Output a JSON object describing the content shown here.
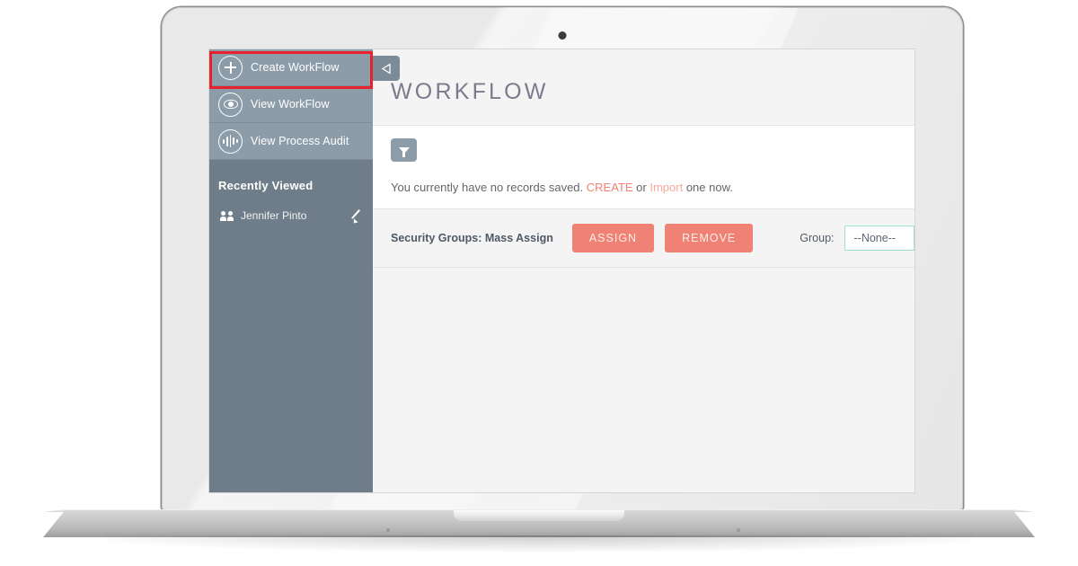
{
  "app": {
    "sidebar": {
      "nav_items": [
        {
          "label": "Create WorkFlow",
          "icon": "plus-icon"
        },
        {
          "label": "View WorkFlow",
          "icon": "eye-icon"
        },
        {
          "label": "View Process Audit",
          "icon": "audio-bars-icon"
        }
      ],
      "recently_viewed": {
        "header": "Recently Viewed",
        "items": [
          {
            "label": "Jennifer Pinto",
            "icon": "people-icon",
            "action_icon": "pencil-icon"
          }
        ]
      }
    },
    "main": {
      "collapse_toggle_icon": "caret-left-icon",
      "page_title": "WORKFLOW",
      "filter_button_icon": "funnel-icon",
      "empty_state": {
        "text_before": "You currently have no records saved.",
        "create_link": "CREATE",
        "separator": "or",
        "import_link": "Import",
        "text_after": "one now."
      },
      "mass_assign": {
        "label": "Security Groups: Mass Assign",
        "assign_button": "ASSIGN",
        "remove_button": "REMOVE",
        "group_label": "Group:",
        "group_selected": "--None--"
      }
    }
  },
  "colors": {
    "sidebar_nav": "#8d9ca9",
    "sidebar_recent": "#6e7d89",
    "coral": "#ef8274",
    "coral_light": "#f7a99c",
    "mint": "#9ee0c8",
    "title": "#7d7a8c",
    "highlight": "#e8212d"
  }
}
